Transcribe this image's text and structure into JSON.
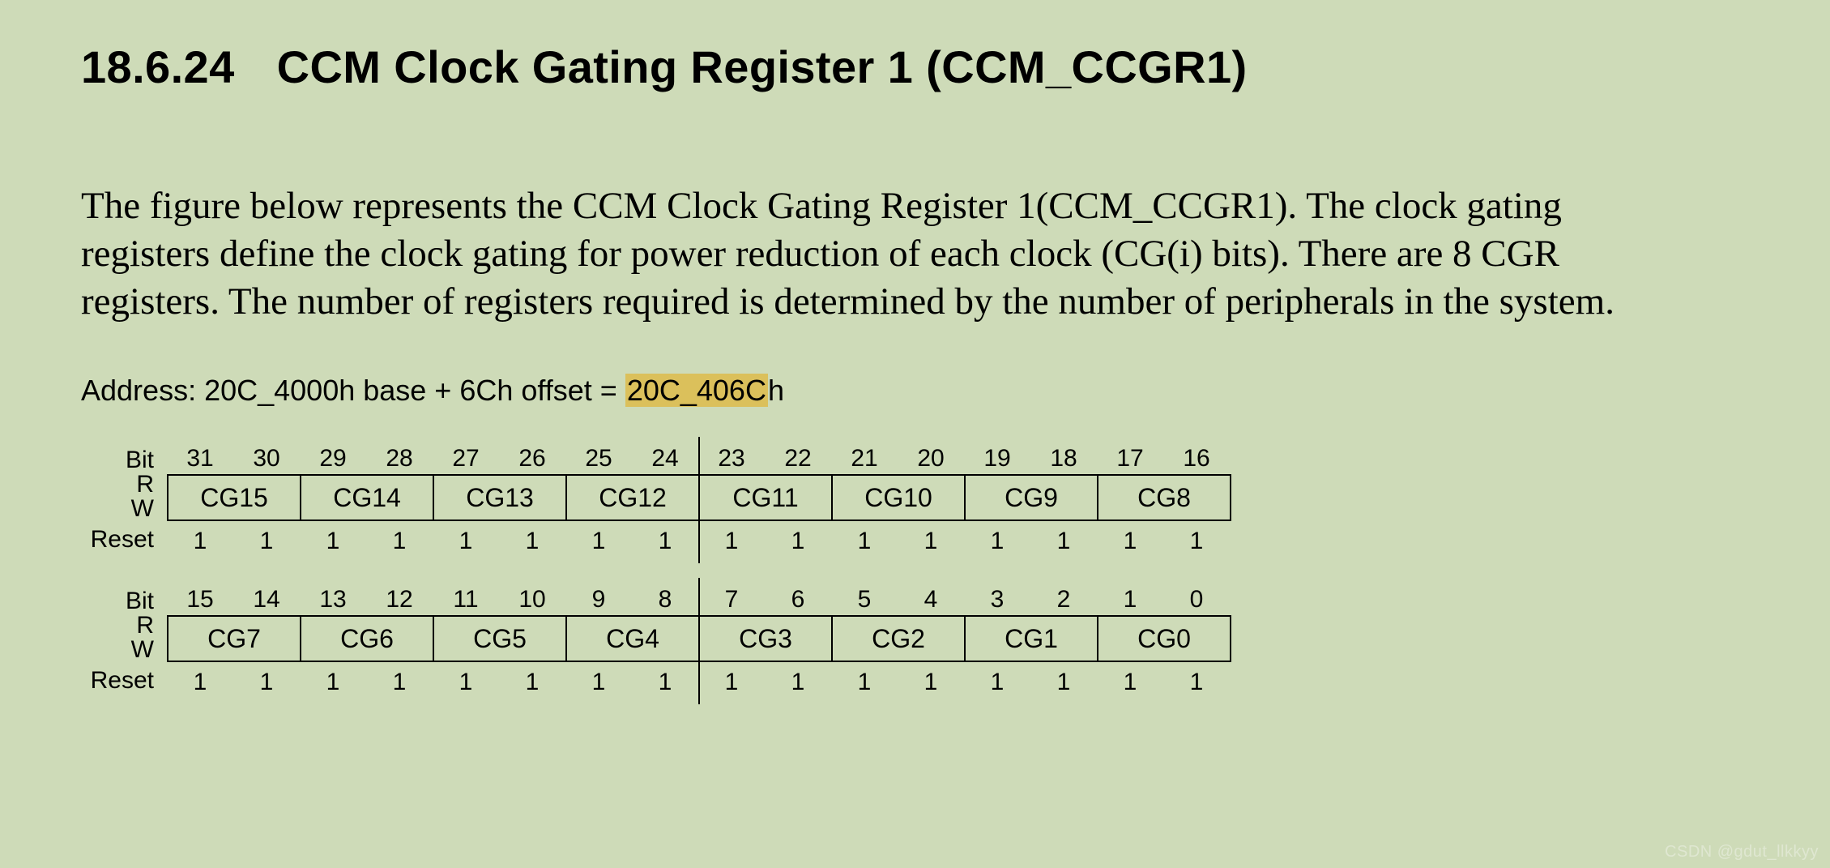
{
  "heading": {
    "secno": "18.6.24",
    "title": "CCM Clock Gating Register 1 (CCM_CCGR1)"
  },
  "paragraph": "The figure below represents the CCM Clock Gating Register 1(CCM_CCGR1). The clock gating registers define the clock gating for power reduction of each clock (CG(i) bits). There are 8 CGR registers. The number of registers required is determined by the number of peripherals in the system.",
  "address": {
    "prefix": "Address: 20C_4000h base + 6Ch offset = ",
    "value": "20C_406C",
    "suffix": "h"
  },
  "labels": {
    "bit": "Bit",
    "r": "R",
    "w": "W",
    "reset": "Reset"
  },
  "rows": [
    {
      "bits": [
        "31",
        "30",
        "29",
        "28",
        "27",
        "26",
        "25",
        "24",
        "23",
        "22",
        "21",
        "20",
        "19",
        "18",
        "17",
        "16"
      ],
      "fields": [
        "CG15",
        "CG14",
        "CG13",
        "CG12",
        "CG11",
        "CG10",
        "CG9",
        "CG8"
      ],
      "reset": [
        "1",
        "1",
        "1",
        "1",
        "1",
        "1",
        "1",
        "1",
        "1",
        "1",
        "1",
        "1",
        "1",
        "1",
        "1",
        "1"
      ]
    },
    {
      "bits": [
        "15",
        "14",
        "13",
        "12",
        "11",
        "10",
        "9",
        "8",
        "7",
        "6",
        "5",
        "4",
        "3",
        "2",
        "1",
        "0"
      ],
      "fields": [
        "CG7",
        "CG6",
        "CG5",
        "CG4",
        "CG3",
        "CG2",
        "CG1",
        "CG0"
      ],
      "reset": [
        "1",
        "1",
        "1",
        "1",
        "1",
        "1",
        "1",
        "1",
        "1",
        "1",
        "1",
        "1",
        "1",
        "1",
        "1",
        "1"
      ]
    }
  ],
  "watermark": "CSDN @gdut_llkkyy"
}
